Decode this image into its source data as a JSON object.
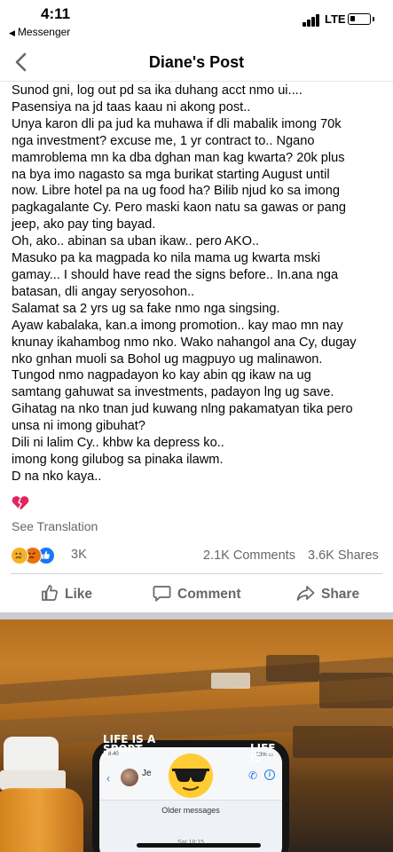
{
  "status_bar": {
    "time": "4:11",
    "back_app": "Messenger",
    "network": "LTE"
  },
  "nav": {
    "title": "Diane's Post",
    "back_icon": "chevron-left-icon"
  },
  "post": {
    "lines": [
      "Sunod gni, log out pd sa ika duhang acct nmo ui....",
      "Pasensiya na jd taas kaau ni akong post..",
      "Unya karon dli pa jud ka muhawa if dli mabalik imong 70k",
      "nga investment? excuse me, 1 yr contract to.. Ngano",
      "mamroblema mn ka dba dghan man kag kwarta? 20k plus",
      "na bya imo nagasto sa mga burikat starting August until",
      "now. Libre hotel pa na ug food ha? Bilib njud ko sa imong",
      "pagkagalante Cy. Pero maski kaon natu sa gawas or pang",
      "jeep, ako pay ting bayad.",
      "Oh, ako.. abinan sa uban ikaw.. pero AKO..",
      "Masuko pa ka magpada ko nila mama ug kwarta mski",
      "gamay... I should have read the signs before.. In.ana nga",
      "batasan, dli angay seryosohon..",
      "Salamat sa 2 yrs ug sa fake nmo nga singsing.",
      "Ayaw kabalaka, kan.a imong promotion.. kay mao mn nay",
      "knunay ikahambog nmo nko. Wako nahangol ana Cy, dugay",
      "nko gnhan muoli sa Bohol ug magpuyo ug malinawon.",
      "Tungod nmo nagpadayon  ko kay abin qg ikaw na ug",
      "samtang gahuwat sa investments, padayon lng ug save.",
      "Gihatag na nko tnan jud kuwang nlng pakamatyan tika pero",
      "unsa ni imong gibuhat?",
      " Dili ni lalim Cy.. khbw ka depress ko..",
      "imong kong gilubog sa pinaka ilawm.",
      "D na nko kaya.."
    ],
    "emoji_icon": "broken-heart-icon",
    "see_translation": "See Translation"
  },
  "stats": {
    "reactions_count": "3K",
    "comments": "2.1K Comments",
    "shares": "3.6K Shares"
  },
  "actions": {
    "like": "Like",
    "comment": "Comment",
    "share": "Share"
  },
  "photo": {
    "older_messages": "Older messages",
    "case_text_left": "LIFE IS A SPORT",
    "case_text_right": "LIFE IS"
  },
  "colors": {
    "text": "#050505",
    "secondary": "#65676b",
    "accent": "#1877f2",
    "broken_heart": "#e0245e"
  }
}
